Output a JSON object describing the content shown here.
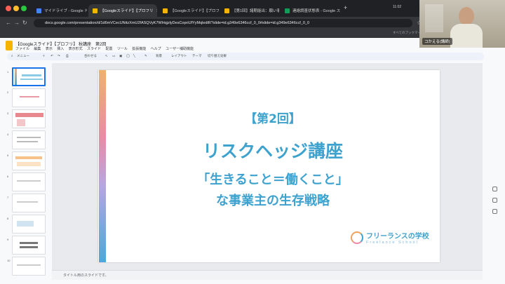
{
  "browser": {
    "tabs": [
      {
        "label": "マイドライブ - Google ドライブ",
        "color": "#4285f4"
      },
      {
        "label": "【Googleスライド】【プロフリ",
        "color": "#f4b400"
      },
      {
        "label": "【Googleスライド】【プロフ",
        "color": "#f4b400"
      },
      {
        "label": "【第1回】諸期能出：願い事業主",
        "color": "#f4b400"
      },
      {
        "label": "連絡調査状態表 - Google スプ",
        "color": "#0f9d58"
      }
    ],
    "new_tab": "+",
    "address": "docs.google.com/presentation/d/1d6mVCecUNitzXmU2fASQVyK7WHqjzlyDesCopriUfYyMqlediR?slide=id.g349e6346ccf_0_0#slide=id.g349e6346ccf_0_0",
    "bookmarks": [
      "すべてのブックマーク"
    ],
    "time": "11:02"
  },
  "app": {
    "doc_title": "【Googleスライド】【プロフリ】 秋講座　第2回",
    "menus": [
      "ファイル",
      "編集",
      "表示",
      "挿入",
      "表示形式",
      "スライド",
      "配置",
      "ツール",
      "拡張機能",
      "ヘルプ",
      "ユーザー補助機能"
    ],
    "toolbar": {
      "menu_search": "メニュー",
      "zoom": "合わせる",
      "background": "背景",
      "layout": "レイアウト",
      "theme": "テーマ",
      "transition": "切り替え効果"
    },
    "slide_numbers": [
      "1",
      "2",
      "3",
      "4",
      "5",
      "6",
      "7",
      "8",
      "9",
      "10"
    ],
    "slide": {
      "line1": "【第2回】",
      "line2": "リスクヘッジ講座",
      "line3": "「生きること＝働くこと」",
      "line4": "な事業主の生存戦略",
      "logo": "フリーランスの学校",
      "logo_sub": "Freelance School"
    },
    "notes": "タイトル用のスライドです。"
  },
  "webcam": {
    "name": "コかえる(講師)"
  },
  "colors": {
    "accent_text": "#3ea2cf",
    "selection": "#1a73e8"
  }
}
